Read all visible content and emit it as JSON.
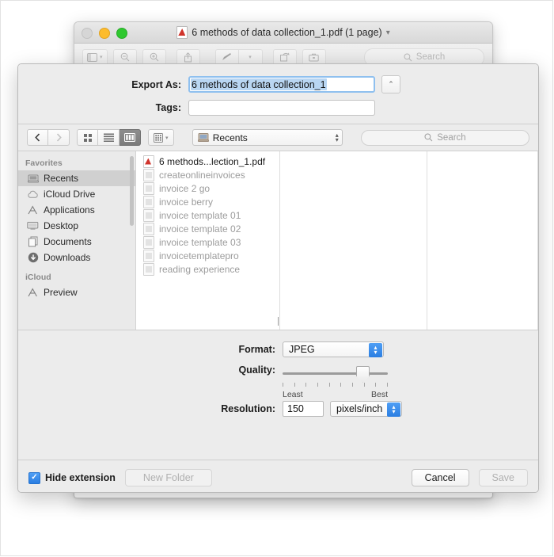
{
  "preview_window": {
    "title": "6 methods of data collection_1.pdf (1 page)",
    "title_chevron": "chevron-down",
    "traffic_lights": [
      "close",
      "minimize",
      "zoom"
    ],
    "toolbar": {
      "sidebar_toggle": "sidebar-icon",
      "zoom_out": "zoom-out-icon",
      "zoom_in": "zoom-in-icon",
      "share": "share-icon",
      "markup": "markup-pen-icon",
      "markup_menu": "chevron-down-icon",
      "rotate": "rotate-icon",
      "toolbox": "toolbox-icon",
      "search_placeholder": "Search"
    }
  },
  "sheet": {
    "export_as_label": "Export As:",
    "export_as_value": "6 methods of data collection_1",
    "tags_label": "Tags:",
    "tags_value": "",
    "disclosure_glyph": "⌃",
    "browser_bar": {
      "back_glyph": "‹",
      "forward_glyph": "›",
      "view_icon": "icon-view",
      "view_list": "list-view",
      "view_column": "column-view",
      "arrange_label": "arrange-icon",
      "location": "Recents",
      "search_placeholder": "Search"
    },
    "sidebar": {
      "sections": [
        {
          "header": "Favorites",
          "items": [
            {
              "label": "Recents",
              "icon": "recents-icon",
              "selected": true
            },
            {
              "label": "iCloud Drive",
              "icon": "cloud-icon",
              "selected": false
            },
            {
              "label": "Applications",
              "icon": "applications-icon",
              "selected": false
            },
            {
              "label": "Desktop",
              "icon": "desktop-icon",
              "selected": false
            },
            {
              "label": "Documents",
              "icon": "documents-icon",
              "selected": false
            },
            {
              "label": "Downloads",
              "icon": "downloads-icon",
              "selected": false
            }
          ]
        },
        {
          "header": "iCloud",
          "items": [
            {
              "label": "Preview",
              "icon": "applications-icon",
              "selected": false
            }
          ]
        }
      ]
    },
    "files": [
      {
        "name": "6 methods...lection_1.pdf",
        "type": "pdf",
        "dim": false
      },
      {
        "name": "createonlineinvoices",
        "type": "doc",
        "dim": true
      },
      {
        "name": "invoice 2 go",
        "type": "doc",
        "dim": true
      },
      {
        "name": "invoice berry",
        "type": "doc",
        "dim": true
      },
      {
        "name": "invoice template 01",
        "type": "doc",
        "dim": true
      },
      {
        "name": "invoice template 02",
        "type": "doc",
        "dim": true
      },
      {
        "name": "invoice template 03",
        "type": "doc",
        "dim": true
      },
      {
        "name": "invoicetemplatepro",
        "type": "doc",
        "dim": true
      },
      {
        "name": "reading experience",
        "type": "doc",
        "dim": true
      }
    ],
    "options": {
      "format_label": "Format:",
      "format_value": "JPEG",
      "quality_label": "Quality:",
      "quality_least": "Least",
      "quality_best": "Best",
      "quality_percent": 72,
      "quality_ticks": 10,
      "resolution_label": "Resolution:",
      "resolution_value": "150",
      "resolution_unit": "pixels/inch"
    },
    "footer": {
      "hide_extension_label": "Hide extension",
      "hide_extension_checked": true,
      "check_glyph": "✓",
      "new_folder_label": "New Folder",
      "cancel_label": "Cancel",
      "save_label": "Save"
    }
  },
  "colors": {
    "accent_blue": "#2a7de1",
    "selection_blue": "#b9d6f2",
    "pdf_red": "#d0342c",
    "document_band_red": "#d81f26",
    "sheet_background": "#ececec"
  }
}
